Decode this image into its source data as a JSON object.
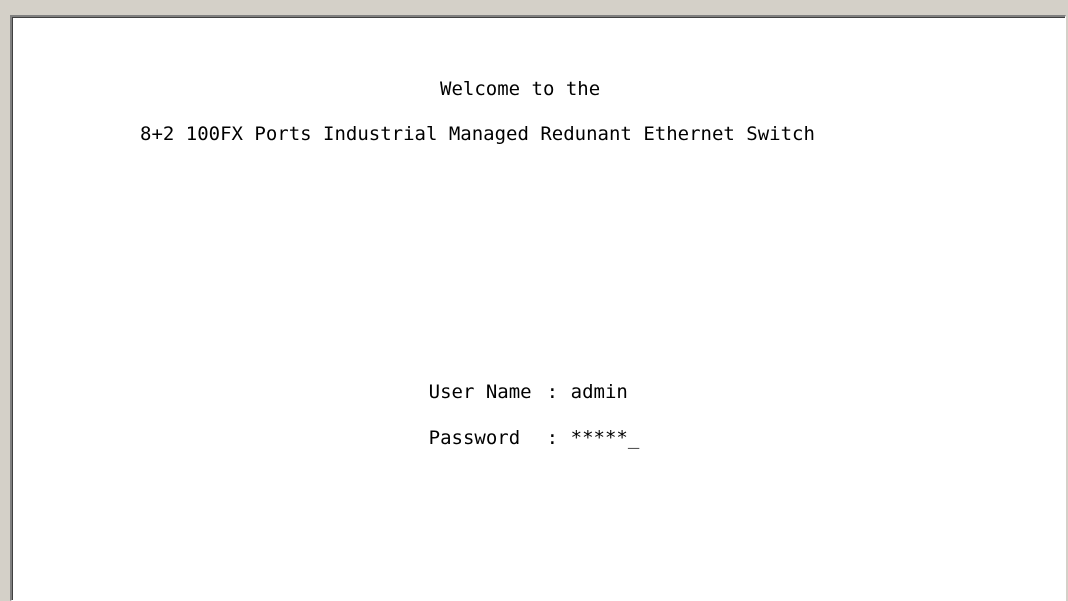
{
  "terminal": {
    "welcome_line": "Welcome to the",
    "product_title": "8+2 100FX Ports Industrial Managed Redunant Ethernet Switch",
    "login": {
      "username_label": "User Name",
      "username_separator": ":",
      "username_value": "admin",
      "password_label": "Password",
      "password_separator": ":",
      "password_value": "*****",
      "cursor": "_"
    }
  }
}
